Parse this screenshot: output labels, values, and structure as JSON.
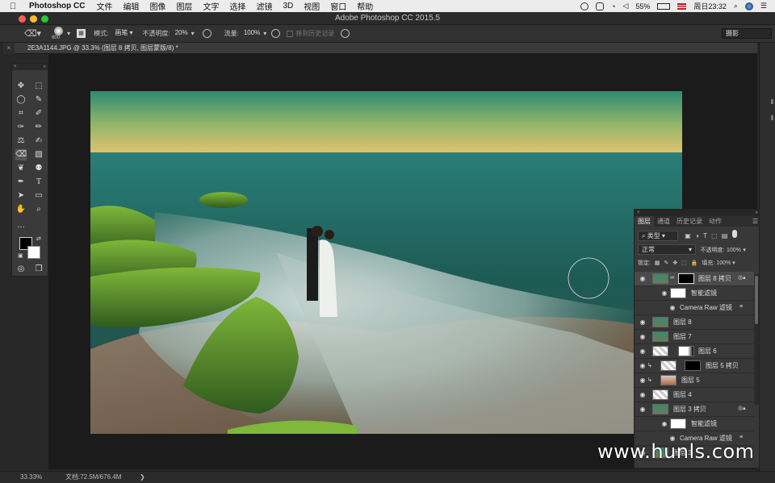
{
  "menubar": {
    "app_name": "Photoshop CC",
    "items": [
      "文件",
      "编辑",
      "图像",
      "图层",
      "文字",
      "选择",
      "滤镜",
      "3D",
      "视图",
      "窗口",
      "帮助"
    ],
    "battery": "55%",
    "clock": "周日23:32"
  },
  "window": {
    "title": "Adobe Photoshop CC 2015.5"
  },
  "options": {
    "brush_size": "600",
    "mode_label": "模式:",
    "mode_value": "画笔",
    "opacity_label": "不透明度:",
    "opacity_value": "20%",
    "flow_label": "流量:",
    "flow_value": "100%",
    "history_label": "抹到历史记录",
    "workspace": "摄影"
  },
  "document": {
    "tab_title": "2E3A1144.JPG @ 33.3% (图层 8 拷贝, 图层蒙版/8) *"
  },
  "status": {
    "zoom": "33.33%",
    "doc_size": "文档:72.5M/676.4M"
  },
  "layers_panel": {
    "tabs": [
      "图层",
      "通道",
      "历史记录",
      "动作"
    ],
    "filter_kind": "类型",
    "blend_mode": "正常",
    "opacity_label": "不透明度:",
    "opacity_value": "100%",
    "lock_label": "锁定:",
    "fill_label": "填充:",
    "fill_value": "100%",
    "layers": [
      {
        "name": "图层 8 拷贝",
        "kind": "smart"
      },
      {
        "name": "智能滤镜",
        "kind": "sub"
      },
      {
        "name": "Camera Raw 滤镜",
        "kind": "subsub"
      },
      {
        "name": "图层 8",
        "kind": "normal"
      },
      {
        "name": "图层 7",
        "kind": "normal"
      },
      {
        "name": "图层 6",
        "kind": "mask"
      },
      {
        "name": "图层 5 拷贝",
        "kind": "mask"
      },
      {
        "name": "图层 5",
        "kind": "normal"
      },
      {
        "name": "图层 4",
        "kind": "normal"
      },
      {
        "name": "图层 3 拷贝",
        "kind": "smart"
      },
      {
        "name": "智能滤镜",
        "kind": "sub"
      },
      {
        "name": "Camera Raw 滤镜",
        "kind": "subsub"
      },
      {
        "name": "图层 3",
        "kind": "normal"
      }
    ]
  },
  "watermark": "www.hunls.com"
}
